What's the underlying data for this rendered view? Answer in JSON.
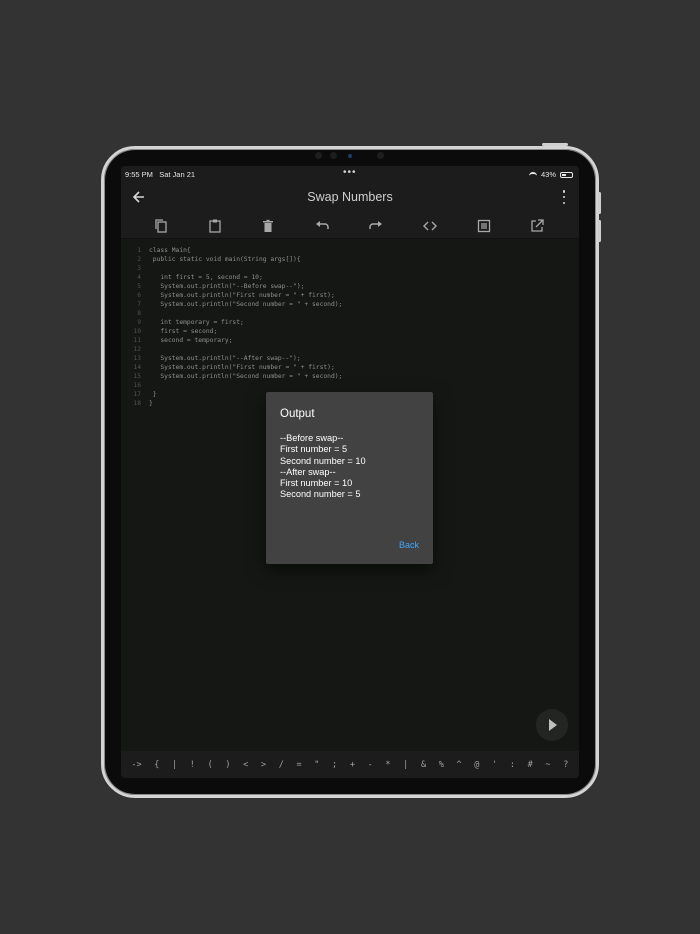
{
  "status": {
    "time": "9:55 PM",
    "date": "Sat Jan 21",
    "battery": "43%",
    "dots": "•••"
  },
  "appbar": {
    "title": "Swap Numbers"
  },
  "editor": {
    "lines": [
      {
        "n": "1",
        "t": "class Main{"
      },
      {
        "n": "2",
        "t": " public static void main(String args[]){"
      },
      {
        "n": "3",
        "t": ""
      },
      {
        "n": "4",
        "t": "   int first = 5, second = 10;"
      },
      {
        "n": "5",
        "t": "   System.out.println(\"--Before swap--\");"
      },
      {
        "n": "6",
        "t": "   System.out.println(\"First number = \" + first);"
      },
      {
        "n": "7",
        "t": "   System.out.println(\"Second number = \" + second);"
      },
      {
        "n": "8",
        "t": ""
      },
      {
        "n": "9",
        "t": "   int temporary = first;"
      },
      {
        "n": "10",
        "t": "   first = second;"
      },
      {
        "n": "11",
        "t": "   second = temporary;"
      },
      {
        "n": "12",
        "t": ""
      },
      {
        "n": "13",
        "t": "   System.out.println(\"--After swap--\");"
      },
      {
        "n": "14",
        "t": "   System.out.println(\"First number = \" + first);"
      },
      {
        "n": "15",
        "t": "   System.out.println(\"Second number = \" + second);"
      },
      {
        "n": "16",
        "t": ""
      },
      {
        "n": "17",
        "t": " }"
      },
      {
        "n": "18",
        "t": "}"
      }
    ]
  },
  "keys": [
    "->",
    "{",
    "|",
    "!",
    "(",
    ")",
    "<",
    ">",
    "/",
    "=",
    "\"",
    ";",
    "+",
    "-",
    "*",
    "|",
    "&",
    "%",
    "^",
    "@",
    "'",
    ":",
    "#",
    "~",
    "?"
  ],
  "dialog": {
    "title": "Output",
    "output": [
      "--Before swap--",
      "First number = 5",
      "Second number = 10",
      "--After swap--",
      "First number = 10",
      "Second number = 5"
    ],
    "back_label": "Back"
  },
  "icons": [
    "copy-icon",
    "paste-icon",
    "delete-icon",
    "undo-icon",
    "redo-icon",
    "code-icon",
    "document-icon",
    "open-external-icon"
  ],
  "colors": {
    "accent": "#42a5f5",
    "dialog_bg": "#424242",
    "editor_bg": "#141714"
  }
}
